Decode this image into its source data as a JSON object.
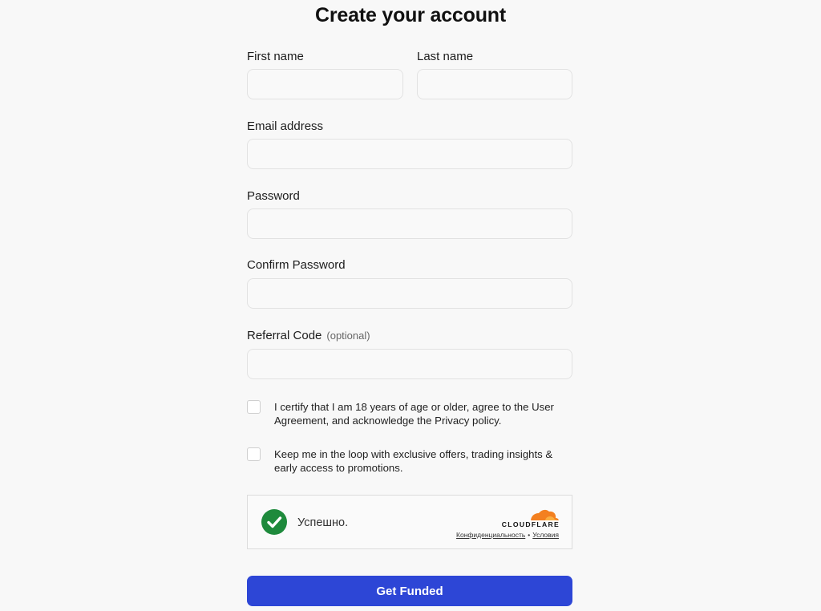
{
  "form": {
    "title": "Create your account",
    "fields": {
      "first_name": {
        "label": "First name",
        "value": "",
        "placeholder": ""
      },
      "last_name": {
        "label": "Last name",
        "value": "",
        "placeholder": ""
      },
      "email": {
        "label": "Email address",
        "value": "",
        "placeholder": ""
      },
      "password": {
        "label": "Password",
        "value": "",
        "placeholder": ""
      },
      "confirm_password": {
        "label": "Confirm Password",
        "value": "",
        "placeholder": ""
      },
      "referral_code": {
        "label": "Referral Code",
        "optional_hint": "(optional)",
        "value": "",
        "placeholder": ""
      }
    },
    "checkboxes": [
      {
        "text": "I certify that I am 18 years of age or older, agree to the User Agreement, and acknowledge the Privacy policy.",
        "checked": false
      },
      {
        "text": "Keep me in the loop with exclusive offers, trading insights & early access to promotions.",
        "checked": false
      }
    ],
    "captcha": {
      "status_text": "Успешно.",
      "brand": "CLOUDFLARE",
      "privacy_link": "Конфиденциальность",
      "separator": "•",
      "terms_link": "Условия",
      "success_color": "#1e8a3c",
      "brand_color": "#f38020"
    },
    "submit_label": "Get Funded",
    "accent_color": "#2d46d6"
  }
}
